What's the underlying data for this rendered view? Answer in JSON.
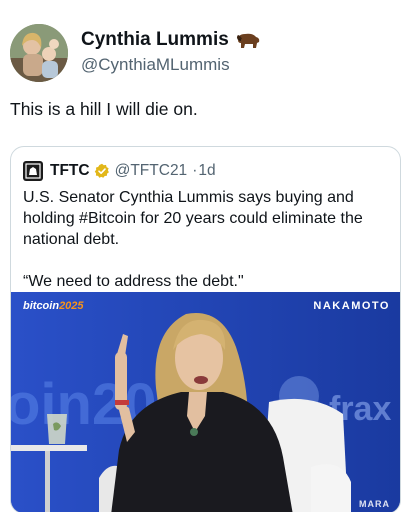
{
  "tweet": {
    "author": {
      "display_name": "Cynthia Lummis",
      "emoji_icon": "bison-icon",
      "handle": "@CynthiaMLummis"
    },
    "text": "This is a hill I will die on."
  },
  "quoted_tweet": {
    "author": {
      "display_name": "TFTC",
      "verified_icon": "verified-badge-icon",
      "handle": "@TFTC21",
      "separator": "·",
      "time": "1d"
    },
    "text_lines": [
      "U.S. Senator Cynthia Lummis says buying and holding #Bitcoin for 20 years could eliminate the national debt.",
      "“We need to address the debt.\""
    ],
    "media": {
      "brand_left": "bitcoin",
      "brand_left_accent": "2025",
      "brand_right": "NAKAMOTO",
      "corner_logo": "MARA"
    }
  },
  "colors": {
    "handle_gray": "#536471",
    "border": "#cfd9de",
    "verified_gold": "#e2b719",
    "stage_blue": "#1c3ea8"
  }
}
